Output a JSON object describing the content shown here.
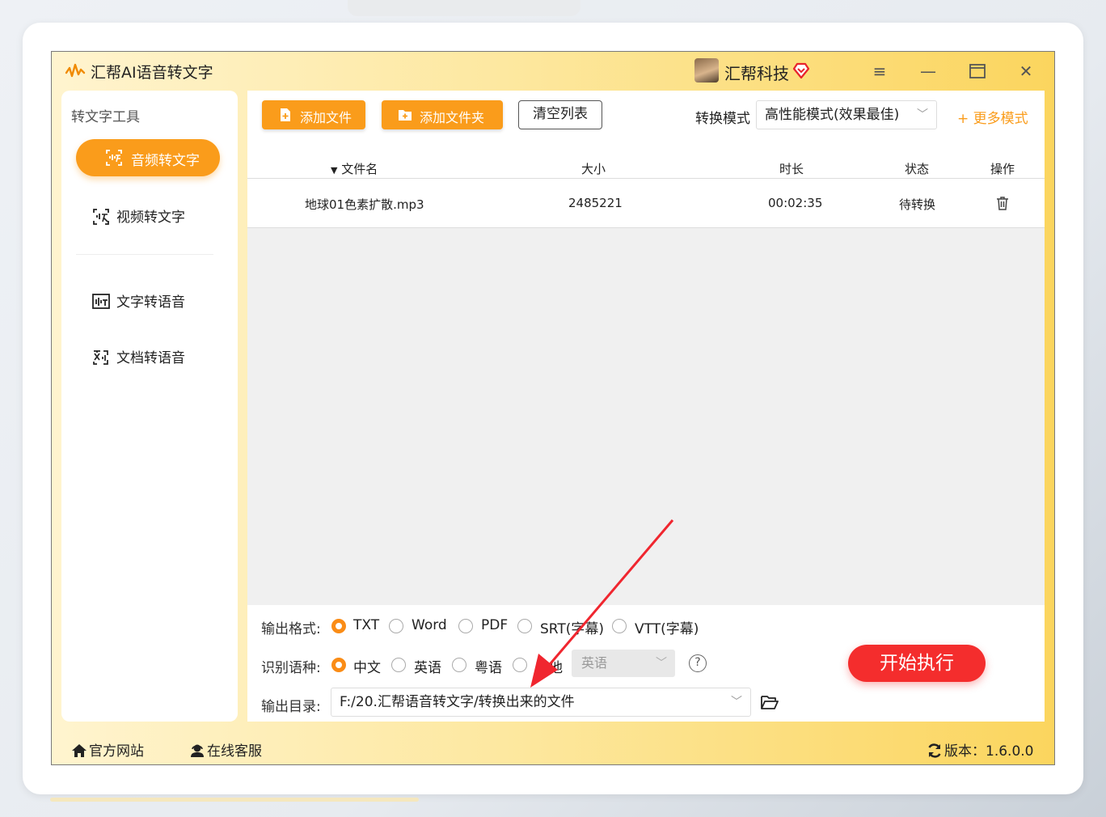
{
  "app": {
    "title": "汇帮AI语音转文字",
    "brand": "汇帮科技"
  },
  "sidebar": {
    "title": "转文字工具",
    "items": [
      {
        "label": "音频转文字"
      },
      {
        "label": "视频转文字"
      },
      {
        "label": "文字转语音"
      },
      {
        "label": "文档转语音"
      }
    ]
  },
  "toolbar": {
    "add_file": "添加文件",
    "add_folder": "添加文件夹",
    "clear_list": "清空列表",
    "mode_label": "转换模式",
    "mode_value": "高性能模式(效果最佳)",
    "more_modes": "+ 更多模式"
  },
  "table": {
    "headers": {
      "name": "文件名",
      "size": "大小",
      "duration": "时长",
      "status": "状态",
      "action": "操作"
    },
    "rows": [
      {
        "name": "地球01色素扩散.mp3",
        "size": "2485221",
        "duration": "00:02:35",
        "status": "待转换"
      }
    ]
  },
  "options": {
    "format_label": "输出格式:",
    "formats": [
      "TXT",
      "Word",
      "PDF",
      "SRT(字幕)",
      "VTT(字幕)"
    ],
    "selected_format": "TXT",
    "lang_label": "识别语种:",
    "langs": [
      "中文",
      "英语",
      "粤语",
      "其他"
    ],
    "selected_lang": "中文",
    "other_lang_value": "英语",
    "help_symbol": "?",
    "dir_label": "输出目录:",
    "dir_value": "F:/20.汇帮语音转文字/转换出来的文件",
    "start_button": "开始执行"
  },
  "footer": {
    "website": "官方网站",
    "support": "在线客服",
    "version": "版本：1.6.0.0"
  },
  "colors": {
    "accent": "#fa9c1b",
    "start": "#f42d2d",
    "annotation_arrow": "#f0262f"
  }
}
